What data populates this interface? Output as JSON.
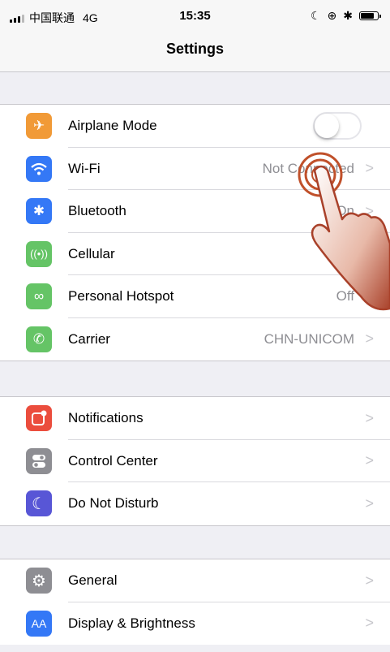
{
  "status_bar": {
    "carrier": "中国联通",
    "network": "4G",
    "time": "15:35",
    "icons": [
      "moon-icon",
      "location-lock-icon",
      "bluetooth-icon",
      "battery-icon"
    ]
  },
  "nav": {
    "title": "Settings"
  },
  "groups": [
    {
      "items": [
        {
          "label": "Airplane Mode",
          "icon": "airplane-icon",
          "color": "#f19a37",
          "control": "toggle",
          "on": false
        },
        {
          "label": "Wi-Fi",
          "icon": "wifi-icon",
          "color": "#3478f6",
          "value": "Not Connected"
        },
        {
          "label": "Bluetooth",
          "icon": "bluetooth-icon",
          "color": "#3478f6",
          "value": "On"
        },
        {
          "label": "Cellular",
          "icon": "cellular-icon",
          "color": "#65c466",
          "value": ""
        },
        {
          "label": "Personal Hotspot",
          "icon": "hotspot-icon",
          "color": "#65c466",
          "value": "Off"
        },
        {
          "label": "Carrier",
          "icon": "phone-icon",
          "color": "#65c466",
          "value": "CHN-UNICOM"
        }
      ]
    },
    {
      "items": [
        {
          "label": "Notifications",
          "icon": "notifications-icon",
          "color": "#eb4d3d",
          "value": ""
        },
        {
          "label": "Control Center",
          "icon": "control-center-icon",
          "color": "#8e8e93",
          "value": ""
        },
        {
          "label": "Do Not Disturb",
          "icon": "moon-icon",
          "color": "#5856d6",
          "value": ""
        }
      ]
    },
    {
      "items": [
        {
          "label": "General",
          "icon": "gear-icon",
          "color": "#8e8e93",
          "value": ""
        },
        {
          "label": "Display & Brightness",
          "icon": "display-brightness-icon",
          "color": "#3478f6",
          "value": ""
        }
      ]
    }
  ],
  "chevron": ">",
  "tap_indicator": {
    "icon": "tap-hand-icon"
  }
}
